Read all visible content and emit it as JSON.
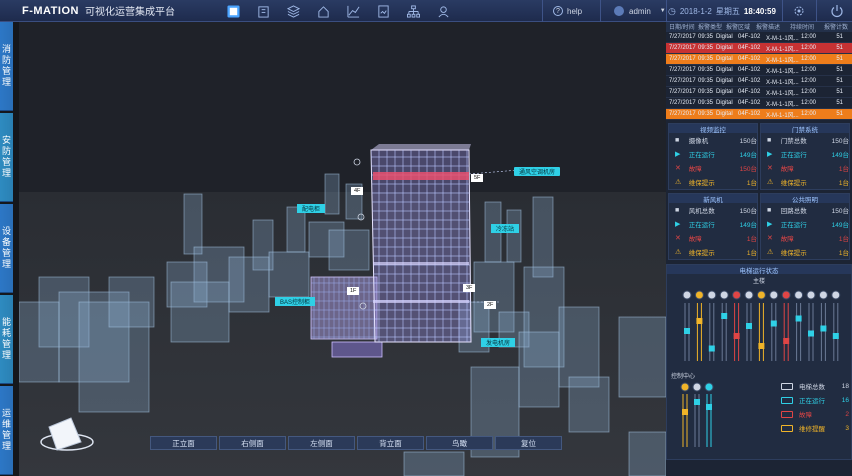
{
  "header": {
    "brand": "F-MATION",
    "subtitle": "可视化运营集成平台",
    "nav": [
      "dashboard-icon",
      "building-icon",
      "layers-icon",
      "home-icon",
      "chart-icon",
      "document-icon",
      "tree-icon",
      "user-icon"
    ],
    "date": "2018-1-2",
    "weekday": "星期五",
    "time": "18:40:59",
    "help": "help",
    "user": "admin"
  },
  "side_menu": [
    "消防管理",
    "安防管理",
    "设备管理",
    "能耗管理",
    "运维管理"
  ],
  "views": [
    "正立面",
    "右侧面",
    "左侧面",
    "背立面",
    "鸟瞰",
    "复位"
  ],
  "scene_labels": [
    "通风空调机房",
    "配电柜",
    "冷冻站",
    "BAS控制柜",
    "发电机房"
  ],
  "scene_tags": [
    "5F",
    "4F",
    "3F",
    "2F",
    "1F"
  ],
  "alarms": {
    "headers": [
      "日期/时间",
      "报警类型",
      "报警区域",
      "报警描述",
      "持续时间",
      "报警计数"
    ],
    "rows": [
      {
        "date": "7/27/2017",
        "time": "09:35",
        "type": "Digital",
        "zone": "04F-102",
        "desc": "X-M-1-1风...",
        "dur": "12:00",
        "count": "51",
        "state": "normal"
      },
      {
        "date": "7/27/2017",
        "time": "09:35",
        "type": "Digital",
        "zone": "04F-102",
        "desc": "X-M-1-1风...",
        "dur": "12:00",
        "count": "51",
        "state": "red"
      },
      {
        "date": "7/27/2017",
        "time": "09:35",
        "type": "Digital",
        "zone": "04F-102",
        "desc": "X-M-1-1风...",
        "dur": "12:00",
        "count": "51",
        "state": "orange"
      },
      {
        "date": "7/27/2017",
        "time": "09:35",
        "type": "Digital",
        "zone": "04F-102",
        "desc": "X-M-1-1风...",
        "dur": "12:00",
        "count": "51",
        "state": "normal"
      },
      {
        "date": "7/27/2017",
        "time": "09:35",
        "type": "Digital",
        "zone": "04F-102",
        "desc": "X-M-1-1风...",
        "dur": "12:00",
        "count": "51",
        "state": "normal"
      },
      {
        "date": "7/27/2017",
        "time": "09:35",
        "type": "Digital",
        "zone": "04F-102",
        "desc": "X-M-1-1风...",
        "dur": "12:00",
        "count": "51",
        "state": "normal"
      },
      {
        "date": "7/27/2017",
        "time": "09:35",
        "type": "Digital",
        "zone": "04F-102",
        "desc": "X-M-1-1风...",
        "dur": "12:00",
        "count": "51",
        "state": "normal"
      },
      {
        "date": "7/27/2017",
        "time": "09:35",
        "type": "Digital",
        "zone": "04F-102",
        "desc": "X-M-1-1风...",
        "dur": "12:00",
        "count": "51",
        "state": "orange"
      }
    ]
  },
  "panels": [
    {
      "title": "视频监控",
      "rows": [
        {
          "label": "摄像机",
          "value": "150台",
          "color": "#cfd6e4"
        },
        {
          "label": "正在运行",
          "value": "149台",
          "color": "#2fd0e6"
        },
        {
          "label": "故障",
          "value": "150台",
          "color": "#e04545"
        },
        {
          "label": "维保提示",
          "value": "1台",
          "color": "#f0b429"
        }
      ]
    },
    {
      "title": "门禁系统",
      "rows": [
        {
          "label": "门禁总数",
          "value": "150台",
          "color": "#cfd6e4"
        },
        {
          "label": "正在运行",
          "value": "149台",
          "color": "#2fd0e6"
        },
        {
          "label": "故障",
          "value": "1台",
          "color": "#e04545"
        },
        {
          "label": "维保提示",
          "value": "1台",
          "color": "#f0b429"
        }
      ]
    },
    {
      "title": "新风机",
      "rows": [
        {
          "label": "风机总数",
          "value": "150台",
          "color": "#cfd6e4"
        },
        {
          "label": "正在运行",
          "value": "149台",
          "color": "#2fd0e6"
        },
        {
          "label": "故障",
          "value": "1台",
          "color": "#e04545"
        },
        {
          "label": "维保提示",
          "value": "1台",
          "color": "#f0b429"
        }
      ]
    },
    {
      "title": "公共照明",
      "rows": [
        {
          "label": "回路总数",
          "value": "150台",
          "color": "#cfd6e4"
        },
        {
          "label": "正在运行",
          "value": "149台",
          "color": "#2fd0e6"
        },
        {
          "label": "故障",
          "value": "1台",
          "color": "#e04545"
        },
        {
          "label": "维保提示",
          "value": "1台",
          "color": "#f0b429"
        }
      ]
    }
  ],
  "elevator": {
    "title": "电梯运行状态",
    "main": "主楼",
    "control": "控制中心",
    "legend": [
      {
        "label": "电梯总数",
        "value": "18",
        "color": "#cfd6e4"
      },
      {
        "label": "正在运行",
        "value": "16",
        "color": "#2fd0e6"
      },
      {
        "label": "故障",
        "value": "2",
        "color": "#e04545"
      },
      {
        "label": "维修提醒",
        "value": "3",
        "color": "#f0b429"
      }
    ]
  }
}
